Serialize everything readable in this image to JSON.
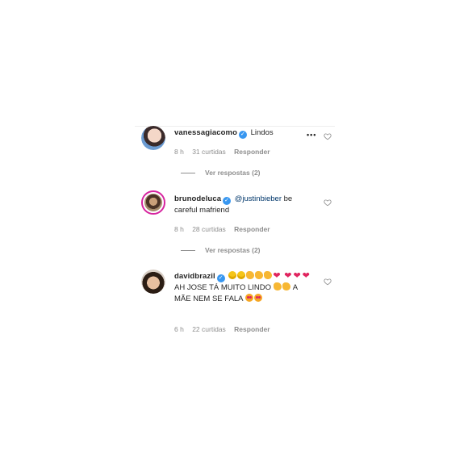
{
  "comments": [
    {
      "username": "vanessagiacomo",
      "verified_icon": "verified-badge-icon",
      "text": "Lindos",
      "time": "8 h",
      "likes": "31 curtidas",
      "reply": "Responder",
      "more": "•••",
      "view_replies": "Ver respostas (2)"
    },
    {
      "username": "brunodeluca",
      "verified_icon": "verified-badge-icon",
      "mention": "@justinbieber",
      "text_rest": " be careful mafriend",
      "time": "8 h",
      "likes": "28 curtidas",
      "reply": "Responder",
      "view_replies": "Ver respostas (2)"
    },
    {
      "username": "davidbrazil",
      "verified_icon": "verified-badge-icon",
      "text_part1": "AH JOSE TÁ MUITO LINDO",
      "text_part2": "A MÃE NEM SE FALA",
      "emoji_names": [
        "laughing-emoji",
        "clapping-emoji",
        "red-heart-emoji",
        "heart-eyes-emoji"
      ],
      "time": "6 h",
      "likes": "22 curtidas",
      "reply": "Responder"
    }
  ],
  "colors": {
    "verified": "#3897f0",
    "mention": "#00376b",
    "meta": "#8e8e8e",
    "heart": "#e0245e"
  }
}
